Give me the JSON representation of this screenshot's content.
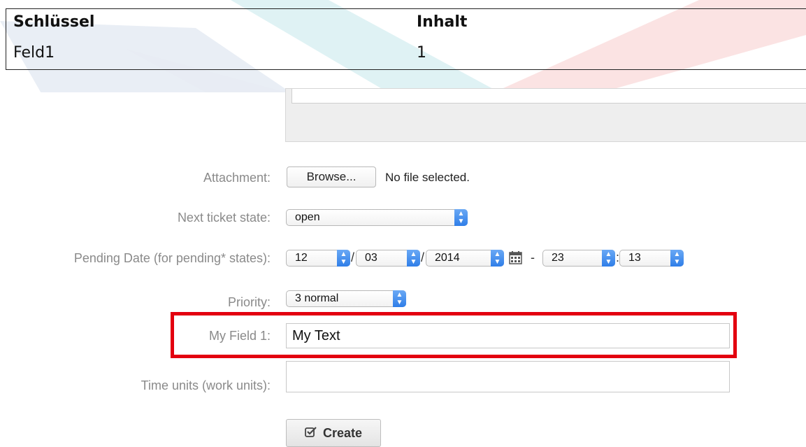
{
  "table": {
    "header_key": "Schlüssel",
    "header_value": "Inhalt",
    "row_key": "Feld1",
    "row_value": "1"
  },
  "form": {
    "attachment": {
      "label": "Attachment:",
      "browse": "Browse...",
      "status": "No file selected."
    },
    "next_state": {
      "label": "Next ticket state:",
      "value": "open"
    },
    "pending": {
      "label": "Pending Date (for pending* states):",
      "day": "12",
      "month": "03",
      "year": "2014",
      "sep1": "/",
      "sep2": "/",
      "dash": "-",
      "hour": "23",
      "colon": ":",
      "minute": "13"
    },
    "priority": {
      "label": "Priority:",
      "value": "3 normal"
    },
    "my_field": {
      "label": "My Field 1:",
      "value": "My Text"
    },
    "time_units": {
      "label": "Time units (work units):",
      "value": ""
    },
    "create": "Create"
  },
  "colors": {
    "highlight": "#e3000f",
    "select_arrow": "#2f7ee8"
  }
}
